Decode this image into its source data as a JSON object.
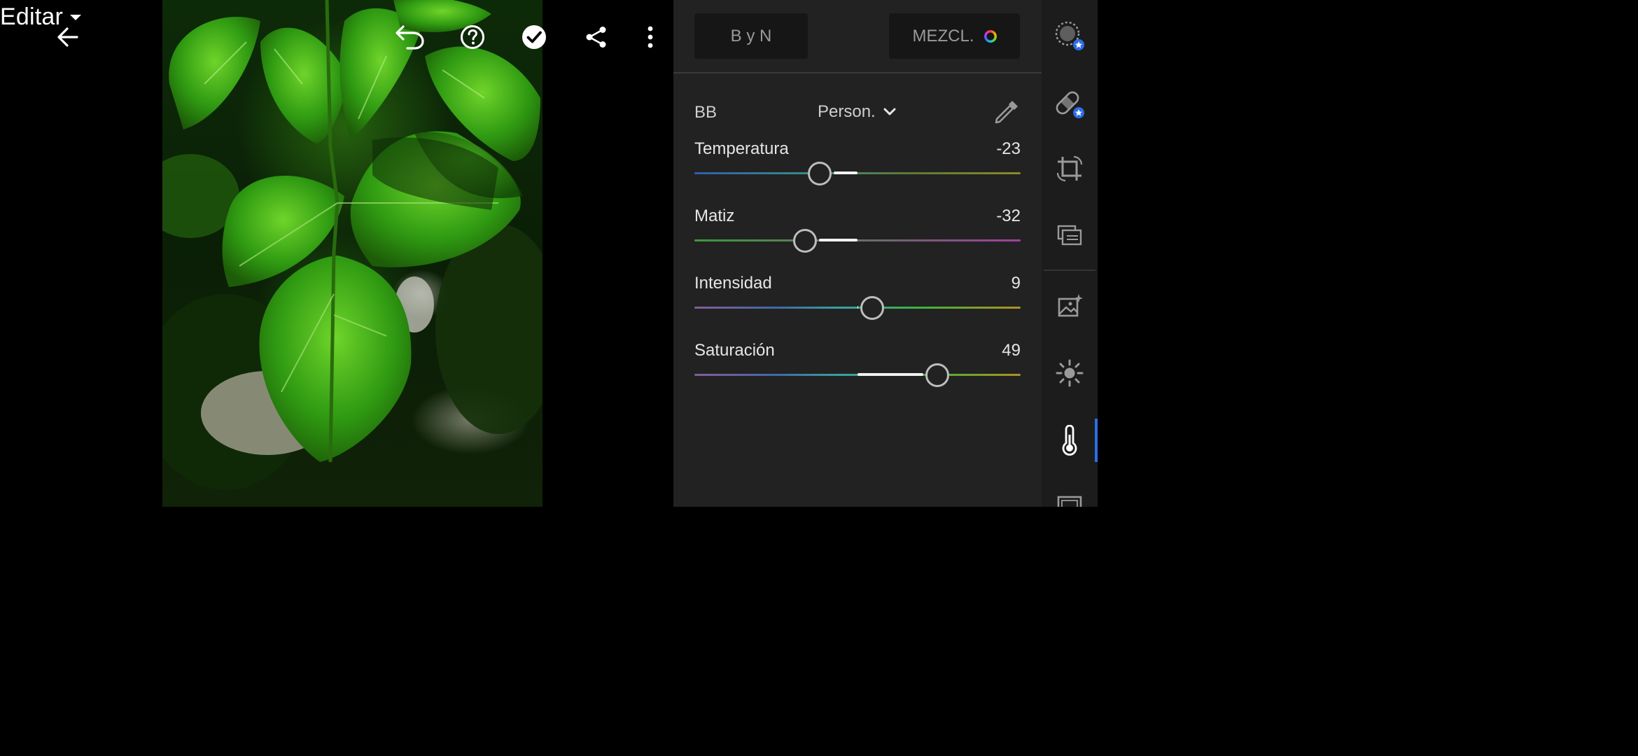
{
  "toolbar": {
    "edit_label": "Editar",
    "icons": [
      "back-arrow-icon",
      "undo-icon",
      "help-icon",
      "done-check-icon",
      "share-icon",
      "more-vertical-icon"
    ]
  },
  "panel": {
    "bw_label": "B y N",
    "mix_label": "MEZCL.",
    "wb": {
      "label": "BB",
      "selected": "Person."
    },
    "sliders": [
      {
        "id": "temp",
        "label": "Temperatura",
        "value": "-23",
        "min": -100,
        "max": 100,
        "pos": -23
      },
      {
        "id": "tint",
        "label": "Matiz",
        "value": "-32",
        "min": -100,
        "max": 100,
        "pos": -32
      },
      {
        "id": "vib",
        "label": "Intensidad",
        "value": "9",
        "min": -100,
        "max": 100,
        "pos": 9
      },
      {
        "id": "sat",
        "label": "Saturación",
        "value": "49",
        "min": -100,
        "max": 100,
        "pos": 49
      }
    ]
  },
  "rail": {
    "items": [
      "healing-brush-icon",
      "bandaid-icon",
      "crop-icon",
      "presets-icon",
      "auto-enhance-icon",
      "light-icon",
      "color-temperature-icon",
      "effects-icon"
    ],
    "active": "color-temperature-icon"
  },
  "colors": {
    "panel_bg": "#222222",
    "rail_bg": "#1c1c1c",
    "active_accent": "#2d6ee8"
  }
}
